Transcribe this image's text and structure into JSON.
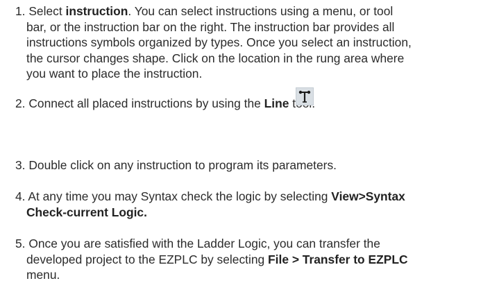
{
  "steps": {
    "s1": {
      "l1a": "1. Select ",
      "l1b": "instruction",
      "l1c": ". You can select instructions using a menu, or tool",
      "l2": "bar, or the instruction bar on the right. The instruction bar provides all",
      "l3": "instructions symbols organized by types. Once you select an instruction,",
      "l4": "the cursor changes shape. Click on the location in the rung area where",
      "l5": "you want to place the instruction."
    },
    "s2": {
      "a": "2. Connect all placed instructions by using the ",
      "b": "Line",
      "c": " tool."
    },
    "s3": {
      "a": "3. Double click on any instruction to program its parameters."
    },
    "s4": {
      "l1a": "4. At any time you may Syntax check the logic by selecting ",
      "l1b": "View>Syntax",
      "l2": "Check-current Logic."
    },
    "s5": {
      "l1": "5. Once you are satisfied with the Ladder Logic, you can transfer the",
      "l2a": "developed project to the EZPLC by selecting ",
      "l2b": "File > Transfer to EZPLC",
      "l3": "menu."
    }
  },
  "icons": {
    "line_tool": "line-tool-icon"
  }
}
